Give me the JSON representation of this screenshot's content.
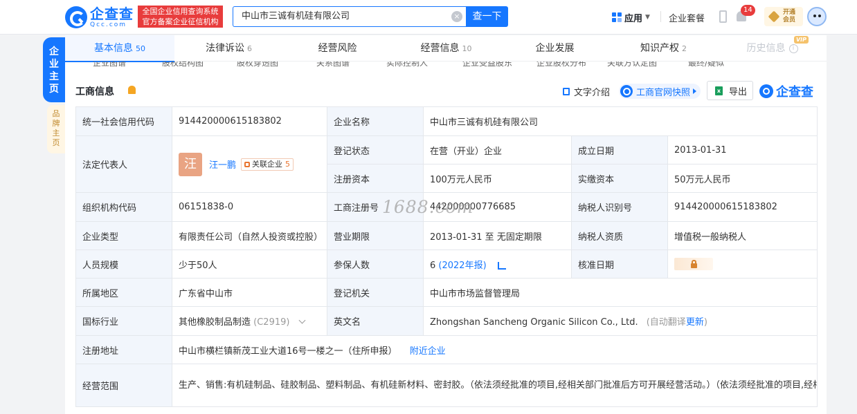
{
  "header": {
    "logo_cn": "企查查",
    "logo_en": "Qcc.com",
    "tagline_line1": "全国企业信用查询系统",
    "tagline_line2": "官方备案企业征信机构",
    "search_value": "中山市三诚有机硅有限公司",
    "search_button": "查一下",
    "apps_label": "应用",
    "package_label": "企业套餐",
    "notification_count": "14",
    "vip_line1": "开通",
    "vip_line2": "会员"
  },
  "side_tabs": {
    "company_home": "企业主页",
    "brand_home": "品牌主页"
  },
  "tabs": [
    {
      "label": "基本信息",
      "count": "50"
    },
    {
      "label": "法律诉讼",
      "count": "6"
    },
    {
      "label": "经营风险",
      "count": ""
    },
    {
      "label": "经营信息",
      "count": "10"
    },
    {
      "label": "企业发展",
      "count": ""
    },
    {
      "label": "知识产权",
      "count": "2"
    },
    {
      "label": "历史信息",
      "count": "",
      "badge": "VIP"
    }
  ],
  "subnav": [
    "企业图谱",
    "股权结构图",
    "股权穿透图",
    "关系图谱",
    "实际控制人",
    "企业受益股东",
    "企业股权分布",
    "关联方认定图",
    "最终/疑似"
  ],
  "section": {
    "title": "工商信息",
    "text_intro": "文字介绍",
    "snapshot": "工商官网快照",
    "export": "导出",
    "brand": "企查查"
  },
  "table": {
    "uscc_label": "统一社会信用代码",
    "uscc_value": "914420000615183802",
    "company_name_label": "企业名称",
    "company_name_value": "中山市三诚有机硅有限公司",
    "legal_rep_label": "法定代表人",
    "legal_rep_avatar": "汪",
    "legal_rep_name": "汪一鹏",
    "related_label": "关联企业",
    "related_count": "5",
    "status_label": "登记状态",
    "status_value": "在营（开业）企业",
    "founded_label": "成立日期",
    "founded_value": "2013-01-31",
    "reg_capital_label": "注册资本",
    "reg_capital_value": "100万元人民币",
    "paid_capital_label": "实缴资本",
    "paid_capital_value": "50万元人民币",
    "org_code_label": "组织机构代码",
    "org_code_value": "06151838-0",
    "reg_no_label": "工商注册号",
    "reg_no_value": "442000000776685",
    "taxpayer_id_label": "纳税人识别号",
    "taxpayer_id_value": "914420000615183802",
    "type_label": "企业类型",
    "type_value": "有限责任公司（自然人投资或控股）",
    "term_label": "营业期限",
    "term_value": "2013-01-31 至 无固定期限",
    "taxpayer_qual_label": "纳税人资质",
    "taxpayer_qual_value": "增值税一般纳税人",
    "staff_label": "人员规模",
    "staff_value": "少于50人",
    "insured_label": "参保人数",
    "insured_value": "6",
    "insured_year": "(2022年报)",
    "approval_label": "核准日期",
    "region_label": "所属地区",
    "region_value": "广东省中山市",
    "authority_label": "登记机关",
    "authority_value": "中山市市场监督管理局",
    "industry_label": "国标行业",
    "industry_value": "其他橡胶制品制造",
    "industry_code": "(C2919)",
    "english_label": "英文名",
    "english_value": "Zhongshan Sancheng Organic Silicon Co., Ltd.",
    "english_note_prefix": "(自动翻译",
    "english_update": "更新",
    "english_note_suffix": ")",
    "address_label": "注册地址",
    "address_value": "中山市横栏镇新茂工业大道16号一楼之一（住所申报）",
    "nearby_link": "附近企业",
    "scope_label": "经营范围",
    "scope_value": "生产、销售:有机硅制品、硅胶制品、塑料制品、有机硅新材料、密封胶。（依法须经批准的项目,经相关部门批准后方可开展经营活动。）（依法须经批准的项目,经相关部门批准后方可开展经营活动）"
  },
  "watermark": "1688.com"
}
